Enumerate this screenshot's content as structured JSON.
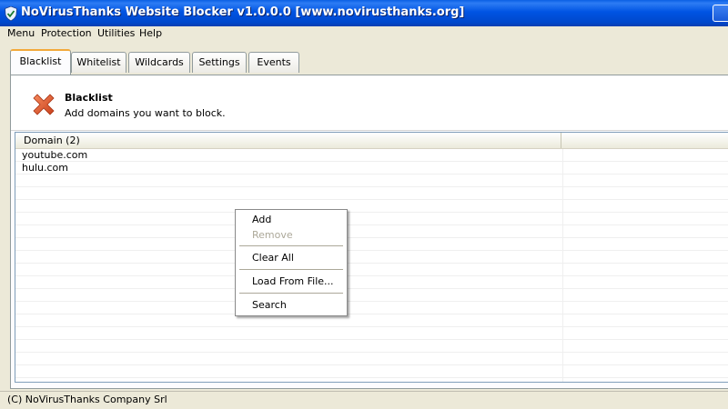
{
  "window": {
    "title": "NoVirusThanks Website Blocker v1.0.0.0 [www.novirusthanks.org]"
  },
  "menu": [
    "Menu",
    "Protection",
    "Utilities",
    "Help"
  ],
  "tabs": [
    "Blacklist",
    "Whitelist",
    "Wildcards",
    "Settings",
    "Events"
  ],
  "active_tab": "Blacklist",
  "header": {
    "icon": "red-x-icon",
    "title": "Blacklist",
    "subtitle": "Add domains you want to block."
  },
  "list": {
    "columns": [
      "Domain (2)",
      ""
    ],
    "rows": [
      "youtube.com",
      "hulu.com"
    ]
  },
  "context_menu": {
    "items": [
      {
        "label": "Add",
        "enabled": true
      },
      {
        "label": "Remove",
        "enabled": false
      },
      {
        "label": "Clear All",
        "enabled": true
      },
      {
        "label": "Load From File...",
        "enabled": true
      },
      {
        "label": "Search",
        "enabled": true
      }
    ]
  },
  "status": "(C) NoVirusThanks Company Srl",
  "colors": {
    "titlebar": "#0054e3",
    "active_tab_highlight": "#f2a93b",
    "x_icon": "#e0502a"
  }
}
